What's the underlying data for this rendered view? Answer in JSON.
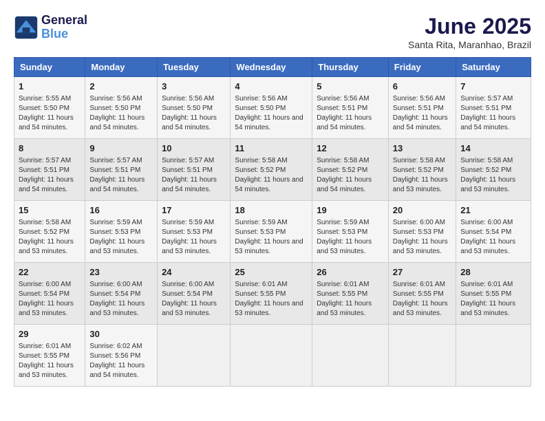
{
  "header": {
    "logo_line1": "General",
    "logo_line2": "Blue",
    "month": "June 2025",
    "location": "Santa Rita, Maranhao, Brazil"
  },
  "days_of_week": [
    "Sunday",
    "Monday",
    "Tuesday",
    "Wednesday",
    "Thursday",
    "Friday",
    "Saturday"
  ],
  "weeks": [
    [
      {
        "day": "1",
        "info": "Sunrise: 5:55 AM\nSunset: 5:50 PM\nDaylight: 11 hours and 54 minutes."
      },
      {
        "day": "2",
        "info": "Sunrise: 5:56 AM\nSunset: 5:50 PM\nDaylight: 11 hours and 54 minutes."
      },
      {
        "day": "3",
        "info": "Sunrise: 5:56 AM\nSunset: 5:50 PM\nDaylight: 11 hours and 54 minutes."
      },
      {
        "day": "4",
        "info": "Sunrise: 5:56 AM\nSunset: 5:50 PM\nDaylight: 11 hours and 54 minutes."
      },
      {
        "day": "5",
        "info": "Sunrise: 5:56 AM\nSunset: 5:51 PM\nDaylight: 11 hours and 54 minutes."
      },
      {
        "day": "6",
        "info": "Sunrise: 5:56 AM\nSunset: 5:51 PM\nDaylight: 11 hours and 54 minutes."
      },
      {
        "day": "7",
        "info": "Sunrise: 5:57 AM\nSunset: 5:51 PM\nDaylight: 11 hours and 54 minutes."
      }
    ],
    [
      {
        "day": "8",
        "info": "Sunrise: 5:57 AM\nSunset: 5:51 PM\nDaylight: 11 hours and 54 minutes."
      },
      {
        "day": "9",
        "info": "Sunrise: 5:57 AM\nSunset: 5:51 PM\nDaylight: 11 hours and 54 minutes."
      },
      {
        "day": "10",
        "info": "Sunrise: 5:57 AM\nSunset: 5:51 PM\nDaylight: 11 hours and 54 minutes."
      },
      {
        "day": "11",
        "info": "Sunrise: 5:58 AM\nSunset: 5:52 PM\nDaylight: 11 hours and 54 minutes."
      },
      {
        "day": "12",
        "info": "Sunrise: 5:58 AM\nSunset: 5:52 PM\nDaylight: 11 hours and 54 minutes."
      },
      {
        "day": "13",
        "info": "Sunrise: 5:58 AM\nSunset: 5:52 PM\nDaylight: 11 hours and 53 minutes."
      },
      {
        "day": "14",
        "info": "Sunrise: 5:58 AM\nSunset: 5:52 PM\nDaylight: 11 hours and 53 minutes."
      }
    ],
    [
      {
        "day": "15",
        "info": "Sunrise: 5:58 AM\nSunset: 5:52 PM\nDaylight: 11 hours and 53 minutes."
      },
      {
        "day": "16",
        "info": "Sunrise: 5:59 AM\nSunset: 5:53 PM\nDaylight: 11 hours and 53 minutes."
      },
      {
        "day": "17",
        "info": "Sunrise: 5:59 AM\nSunset: 5:53 PM\nDaylight: 11 hours and 53 minutes."
      },
      {
        "day": "18",
        "info": "Sunrise: 5:59 AM\nSunset: 5:53 PM\nDaylight: 11 hours and 53 minutes."
      },
      {
        "day": "19",
        "info": "Sunrise: 5:59 AM\nSunset: 5:53 PM\nDaylight: 11 hours and 53 minutes."
      },
      {
        "day": "20",
        "info": "Sunrise: 6:00 AM\nSunset: 5:53 PM\nDaylight: 11 hours and 53 minutes."
      },
      {
        "day": "21",
        "info": "Sunrise: 6:00 AM\nSunset: 5:54 PM\nDaylight: 11 hours and 53 minutes."
      }
    ],
    [
      {
        "day": "22",
        "info": "Sunrise: 6:00 AM\nSunset: 5:54 PM\nDaylight: 11 hours and 53 minutes."
      },
      {
        "day": "23",
        "info": "Sunrise: 6:00 AM\nSunset: 5:54 PM\nDaylight: 11 hours and 53 minutes."
      },
      {
        "day": "24",
        "info": "Sunrise: 6:00 AM\nSunset: 5:54 PM\nDaylight: 11 hours and 53 minutes."
      },
      {
        "day": "25",
        "info": "Sunrise: 6:01 AM\nSunset: 5:55 PM\nDaylight: 11 hours and 53 minutes."
      },
      {
        "day": "26",
        "info": "Sunrise: 6:01 AM\nSunset: 5:55 PM\nDaylight: 11 hours and 53 minutes."
      },
      {
        "day": "27",
        "info": "Sunrise: 6:01 AM\nSunset: 5:55 PM\nDaylight: 11 hours and 53 minutes."
      },
      {
        "day": "28",
        "info": "Sunrise: 6:01 AM\nSunset: 5:55 PM\nDaylight: 11 hours and 53 minutes."
      }
    ],
    [
      {
        "day": "29",
        "info": "Sunrise: 6:01 AM\nSunset: 5:55 PM\nDaylight: 11 hours and 53 minutes."
      },
      {
        "day": "30",
        "info": "Sunrise: 6:02 AM\nSunset: 5:56 PM\nDaylight: 11 hours and 54 minutes."
      },
      {
        "day": "",
        "info": ""
      },
      {
        "day": "",
        "info": ""
      },
      {
        "day": "",
        "info": ""
      },
      {
        "day": "",
        "info": ""
      },
      {
        "day": "",
        "info": ""
      }
    ]
  ]
}
